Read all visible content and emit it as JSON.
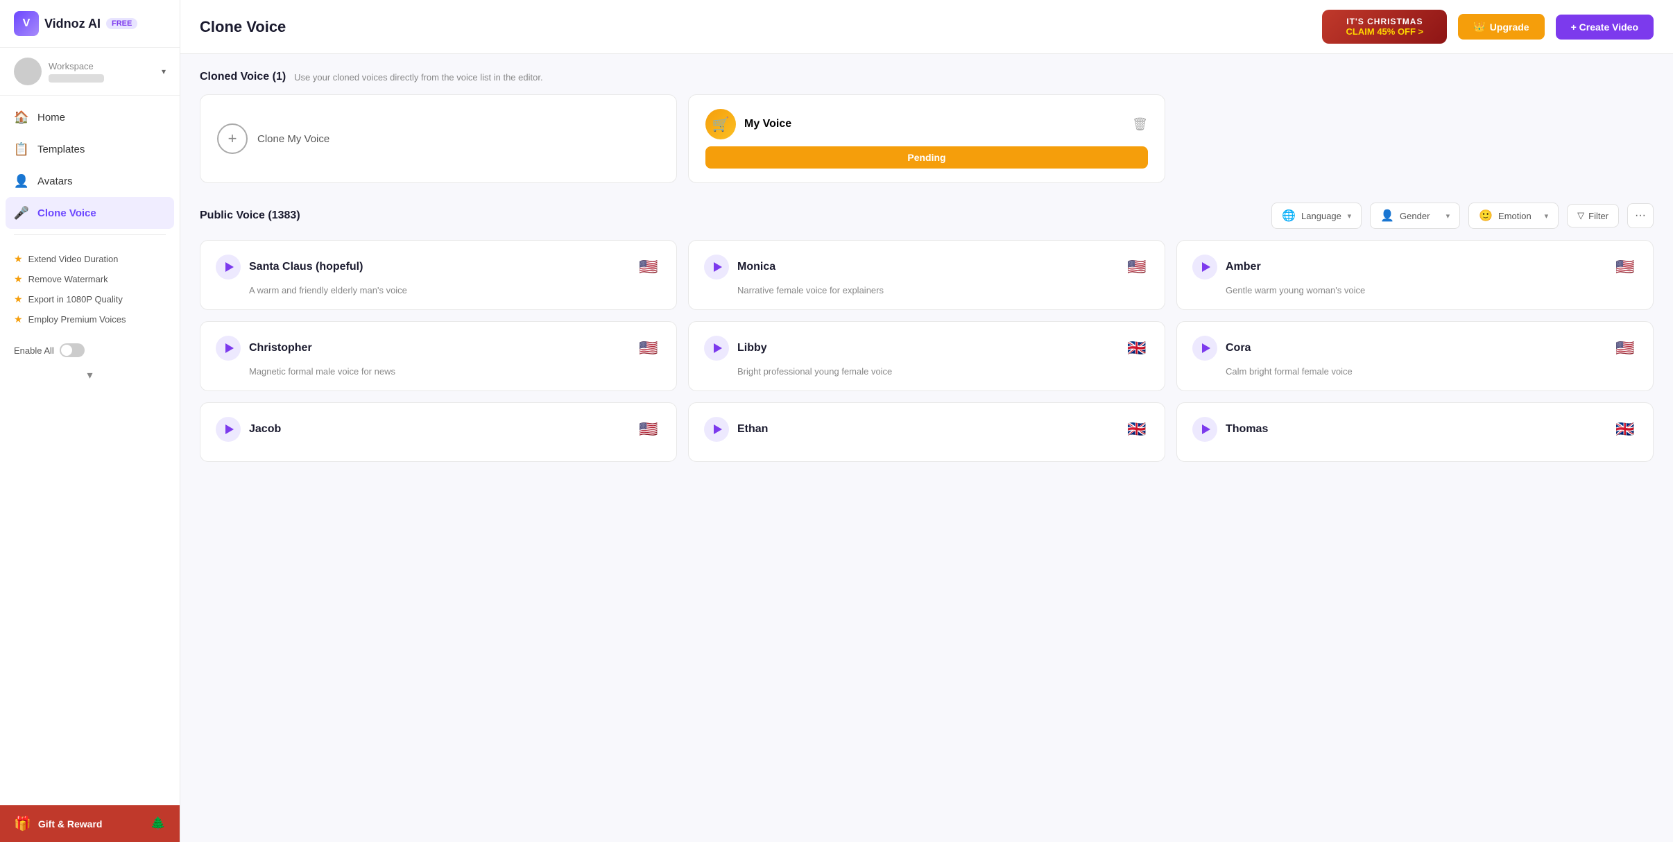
{
  "logo": {
    "icon": "V",
    "name": "Vidnoz AI",
    "badge": "FREE"
  },
  "workspace": {
    "label": "Workspace"
  },
  "nav": {
    "items": [
      {
        "id": "home",
        "label": "Home",
        "icon": "🏠",
        "active": false
      },
      {
        "id": "templates",
        "label": "Templates",
        "icon": "📋",
        "active": false
      },
      {
        "id": "avatars",
        "label": "Avatars",
        "icon": "👤",
        "active": false
      },
      {
        "id": "clone-voice",
        "label": "Clone Voice",
        "icon": "🎤",
        "active": true
      }
    ]
  },
  "premium": {
    "items": [
      {
        "label": "Extend Video Duration"
      },
      {
        "label": "Remove Watermark"
      },
      {
        "label": "Export in 1080P Quality"
      },
      {
        "label": "Employ Premium Voices"
      }
    ],
    "enable_all": "Enable All"
  },
  "gift": {
    "label": "Gift & Reward"
  },
  "header": {
    "title": "Clone Voice",
    "christmas": {
      "top": "IT'S CHRISTMAS",
      "bottom": "CLAIM 45% OFF >"
    },
    "upgrade": "Upgrade",
    "create_video": "+ Create Video"
  },
  "cloned_section": {
    "title": "Cloned Voice (1)",
    "subtitle": "Use your cloned voices directly from the voice list in the editor.",
    "clone_btn": "Clone My Voice",
    "my_voice": {
      "name": "My Voice",
      "status": "Pending"
    }
  },
  "public_section": {
    "title": "Public Voice (1383)",
    "filters": {
      "language": "Language",
      "gender": "Gender",
      "emotion": "Emotion",
      "filter": "Filter"
    }
  },
  "voices": [
    {
      "id": "santa",
      "name": "Santa Claus (hopeful)",
      "desc": "A warm and friendly elderly man's voice",
      "flag": "🇺🇸"
    },
    {
      "id": "monica",
      "name": "Monica",
      "desc": "Narrative female voice for explainers",
      "flag": "🇺🇸"
    },
    {
      "id": "amber",
      "name": "Amber",
      "desc": "Gentle warm young woman's voice",
      "flag": "🇺🇸"
    },
    {
      "id": "christopher",
      "name": "Christopher",
      "desc": "Magnetic formal male voice for news",
      "flag": "🇺🇸"
    },
    {
      "id": "libby",
      "name": "Libby",
      "desc": "Bright professional young female voice",
      "flag": "🇬🇧"
    },
    {
      "id": "cora",
      "name": "Cora",
      "desc": "Calm bright formal female voice",
      "flag": "🇺🇸"
    },
    {
      "id": "jacob",
      "name": "Jacob",
      "desc": "",
      "flag": "🇺🇸"
    },
    {
      "id": "ethan",
      "name": "Ethan",
      "desc": "",
      "flag": "🇬🇧"
    },
    {
      "id": "thomas",
      "name": "Thomas",
      "desc": "",
      "flag": "🇬🇧"
    }
  ]
}
